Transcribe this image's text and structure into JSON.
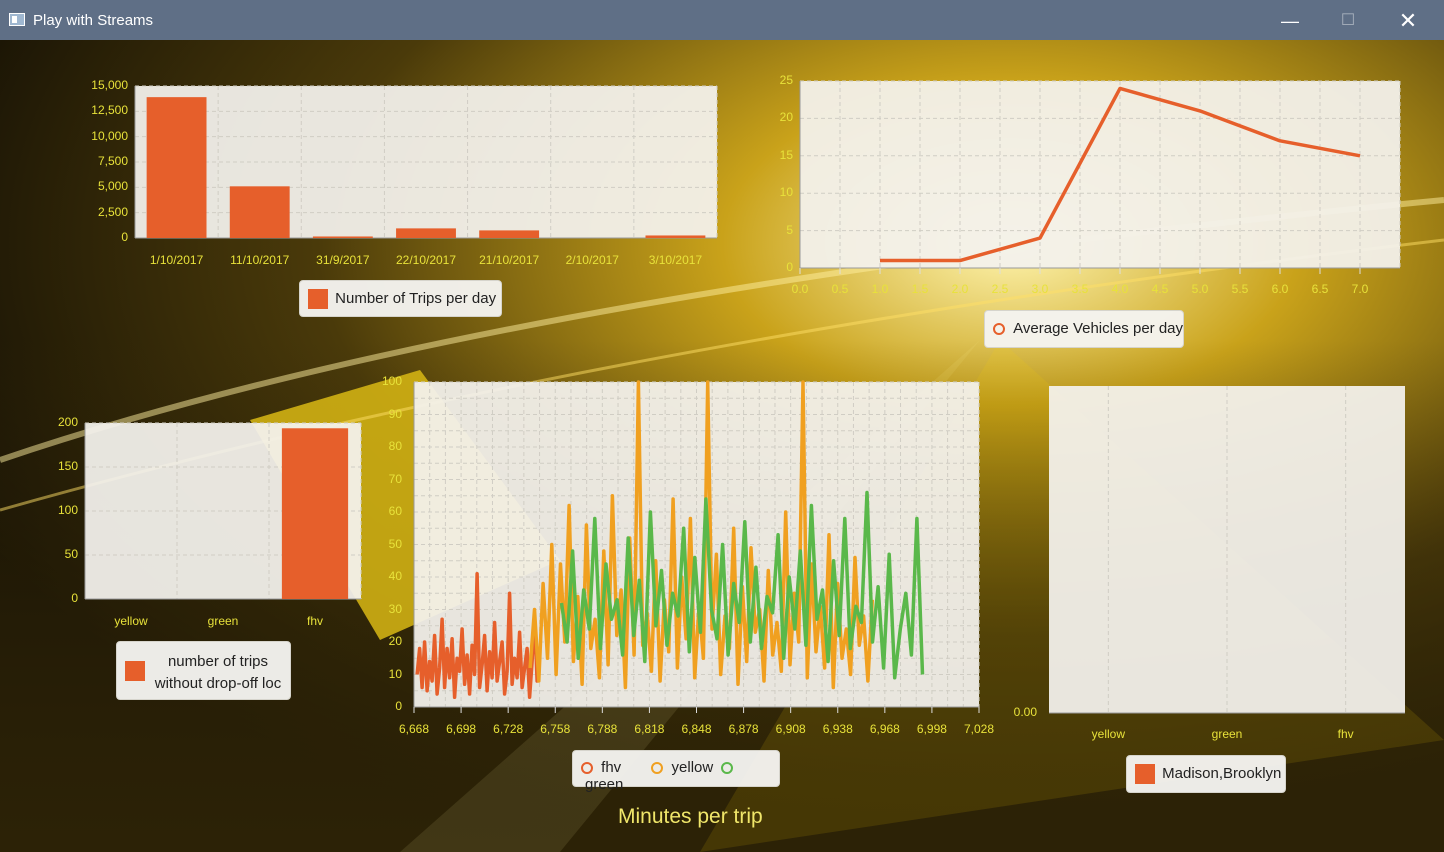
{
  "window": {
    "title": "Play with Streams",
    "min_glyph": "—",
    "max_glyph": "☐",
    "close_glyph": "✕"
  },
  "colors": {
    "accent": "#e65f2b",
    "fhv": "#e65f2b",
    "yellow": "#f0a020",
    "green": "#5ab84a",
    "tick": "#e8e23a",
    "titlebar": "#5f6f86"
  },
  "chart_data": [
    {
      "type": "bar",
      "categories": [
        "1/10/2017",
        "11/10/2017",
        "31/9/2017",
        "22/10/2017",
        "21/10/2017",
        "2/10/2017",
        "3/10/2017"
      ],
      "values": [
        13900,
        5100,
        150,
        950,
        750,
        0,
        250
      ],
      "ylim": [
        0,
        15000
      ],
      "yticks": [
        "15,000",
        "12,500",
        "10,000",
        "7,500",
        "5,000",
        "2,500",
        "0"
      ],
      "legend": "Number of Trips per day"
    },
    {
      "type": "line",
      "x": [
        1.0,
        2.0,
        3.0,
        4.0,
        5.0,
        6.0,
        7.0
      ],
      "y": [
        1.0,
        1.0,
        4.0,
        24.0,
        21.0,
        17.0,
        15.0
      ],
      "xlim": [
        0,
        7.5
      ],
      "ylim": [
        0,
        25
      ],
      "xticks": [
        "0.0",
        "0.5",
        "1.0",
        "1.5",
        "2.0",
        "2.5",
        "3.0",
        "3.5",
        "4.0",
        "4.5",
        "5.0",
        "5.5",
        "6.0",
        "6.5",
        "7.0"
      ],
      "yticks": [
        "25",
        "20",
        "15",
        "10",
        "5",
        "0"
      ],
      "legend": "Average Vehicles per day"
    },
    {
      "type": "bar",
      "categories": [
        "yellow",
        "green",
        "fhv"
      ],
      "values": [
        0,
        0,
        194
      ],
      "ylim": [
        0,
        200
      ],
      "yticks": [
        "200",
        "150",
        "100",
        "50",
        "0"
      ],
      "legend": "number of trips without drop-off loc"
    },
    {
      "type": "line",
      "xlim": [
        6668,
        7028
      ],
      "ylim": [
        0,
        100
      ],
      "xticks": [
        "6,668",
        "6,698",
        "6,728",
        "6,758",
        "6,788",
        "6,818",
        "6,848",
        "6,878",
        "6,908",
        "6,938",
        "6,968",
        "6,998",
        "7,028"
      ],
      "yticks": [
        "100",
        "90",
        "80",
        "70",
        "60",
        "50",
        "40",
        "30",
        "20",
        "10",
        "0"
      ],
      "series": [
        {
          "name": "fhv",
          "x_start": 6670,
          "x_end": 6748,
          "values": [
            10,
            18,
            6,
            20,
            5,
            14,
            8,
            22,
            4,
            12,
            27,
            6,
            18,
            9,
            21,
            3,
            15,
            11,
            24,
            7,
            16,
            4,
            19,
            10,
            41,
            6,
            13,
            22,
            5,
            17,
            9,
            26,
            8,
            14,
            20,
            4,
            11,
            35,
            7,
            15,
            9,
            23,
            6,
            12,
            18,
            3,
            14,
            28,
            8,
            16
          ]
        },
        {
          "name": "yellow",
          "x_start": 6742,
          "x_end": 6960,
          "values": [
            12,
            30,
            8,
            38,
            15,
            50,
            10,
            44,
            20,
            62,
            14,
            34,
            7,
            56,
            18,
            27,
            9,
            48,
            13,
            65,
            22,
            36,
            6,
            52,
            16,
            100,
            19,
            29,
            11,
            45,
            8,
            33,
            17,
            64,
            12,
            40,
            21,
            58,
            9,
            31,
            15,
            100,
            24,
            47,
            10,
            28,
            18,
            55,
            7,
            37,
            14,
            49,
            23,
            30,
            8,
            42,
            16,
            26,
            11,
            60,
            13,
            35,
            20,
            100,
            9,
            44,
            17,
            31,
            12,
            53,
            6,
            38,
            15,
            24,
            10,
            46,
            19,
            28,
            8,
            33
          ]
        },
        {
          "name": "green",
          "x_start": 6762,
          "x_end": 6992,
          "values": [
            32,
            20,
            48,
            15,
            36,
            24,
            58,
            18,
            44,
            27,
            33,
            16,
            52,
            22,
            39,
            14,
            60,
            25,
            42,
            19,
            35,
            28,
            55,
            17,
            46,
            23,
            64,
            30,
            21,
            50,
            16,
            38,
            26,
            57,
            20,
            43,
            18,
            34,
            29,
            53,
            15,
            40,
            24,
            48,
            19,
            62,
            27,
            36,
            14,
            45,
            22,
            58,
            18,
            31,
            26,
            66,
            20,
            37,
            12,
            47,
            9,
            24,
            35,
            16,
            58,
            10
          ]
        }
      ],
      "legend": [
        "fhv",
        "yellow",
        "green"
      ],
      "caption": "Minutes per trip"
    },
    {
      "type": "bar",
      "categories": [
        "yellow",
        "green",
        "fhv"
      ],
      "values": [
        0,
        0,
        0
      ],
      "yticks": [
        "0.00"
      ],
      "legend": "Madison,Brooklyn"
    }
  ]
}
